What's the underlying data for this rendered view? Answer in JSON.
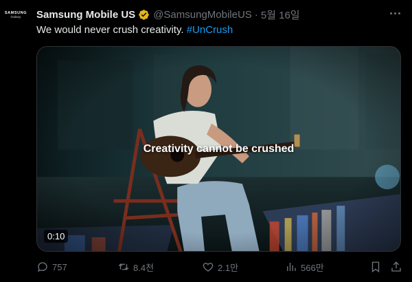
{
  "author": {
    "display_name": "Samsung Mobile US",
    "handle": "@SamsungMobileUS",
    "separator": "·",
    "date": "5월 16일",
    "avatar_brand": "SAMSUNG",
    "avatar_sub": "Galaxy"
  },
  "tweet": {
    "text": "We would never crush creativity. ",
    "hashtag": "#UnCrush"
  },
  "media": {
    "caption": "Creativity cannot be crushed",
    "time": "0:10"
  },
  "actions": {
    "replies": "757",
    "retweets": "8.4천",
    "likes": "2.1만",
    "views": "566만"
  },
  "colors": {
    "link": "#1d9bf0",
    "muted": "#71767b",
    "verified_badge": "#e2b719"
  }
}
